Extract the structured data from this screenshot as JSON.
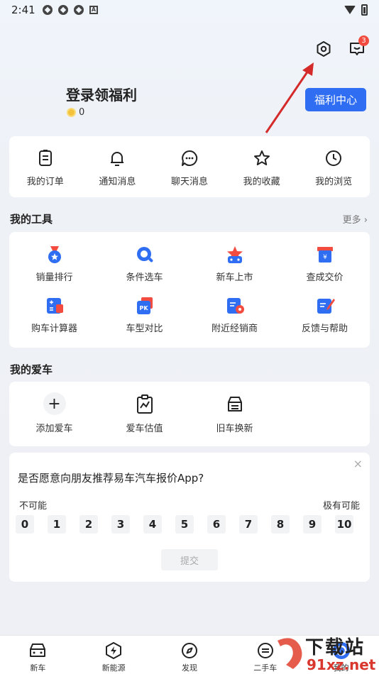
{
  "status_bar": {
    "time": "2:41",
    "notification_letter": "A"
  },
  "header": {
    "message_badge": "3",
    "login_title": "登录领福利",
    "coins": "0",
    "welfare_button": "福利中心"
  },
  "quick_links": [
    {
      "label": "我的订单",
      "icon": "order-icon"
    },
    {
      "label": "通知消息",
      "icon": "bell-icon"
    },
    {
      "label": "聊天消息",
      "icon": "chat-icon"
    },
    {
      "label": "我的收藏",
      "icon": "star-icon"
    },
    {
      "label": "我的浏览",
      "icon": "clock-icon"
    }
  ],
  "tools": {
    "title": "我的工具",
    "more": "更多",
    "items": [
      {
        "label": "销量排行",
        "icon": "medal-icon"
      },
      {
        "label": "条件选车",
        "icon": "search-magnifier-icon"
      },
      {
        "label": "新车上市",
        "icon": "new-car-icon"
      },
      {
        "label": "查成交价",
        "icon": "price-tag-icon"
      },
      {
        "label": "购车计算器",
        "icon": "calculator-icon"
      },
      {
        "label": "车型对比",
        "icon": "pk-compare-icon"
      },
      {
        "label": "附近经销商",
        "icon": "dealer-location-icon"
      },
      {
        "label": "反馈与帮助",
        "icon": "feedback-icon"
      }
    ]
  },
  "my_car": {
    "title": "我的爱车",
    "items": [
      {
        "label": "添加爱车",
        "icon": "plus-icon"
      },
      {
        "label": "爱车估值",
        "icon": "valuation-icon"
      },
      {
        "label": "旧车换新",
        "icon": "car-trade-icon"
      }
    ]
  },
  "survey": {
    "question": "是否愿意向朋友推荐易车汽车报价App?",
    "low_label": "不可能",
    "high_label": "极有可能",
    "scores": [
      "0",
      "1",
      "2",
      "3",
      "4",
      "5",
      "6",
      "7",
      "8",
      "9",
      "10"
    ],
    "submit": "提交",
    "close": "×"
  },
  "tab_bar": [
    {
      "label": "新车",
      "icon": "car-front-icon"
    },
    {
      "label": "新能源",
      "icon": "lightning-icon"
    },
    {
      "label": "发现",
      "icon": "compass-icon"
    },
    {
      "label": "二手车",
      "icon": "used-car-icon"
    },
    {
      "label": "我的",
      "icon": "profile-icon"
    }
  ],
  "watermark": {
    "line1": "下载站",
    "line2": "91xz.net"
  },
  "colors": {
    "accent": "#2f6ef2",
    "badge": "#f24b3f",
    "annotation_arrow": "#d42a2a"
  }
}
